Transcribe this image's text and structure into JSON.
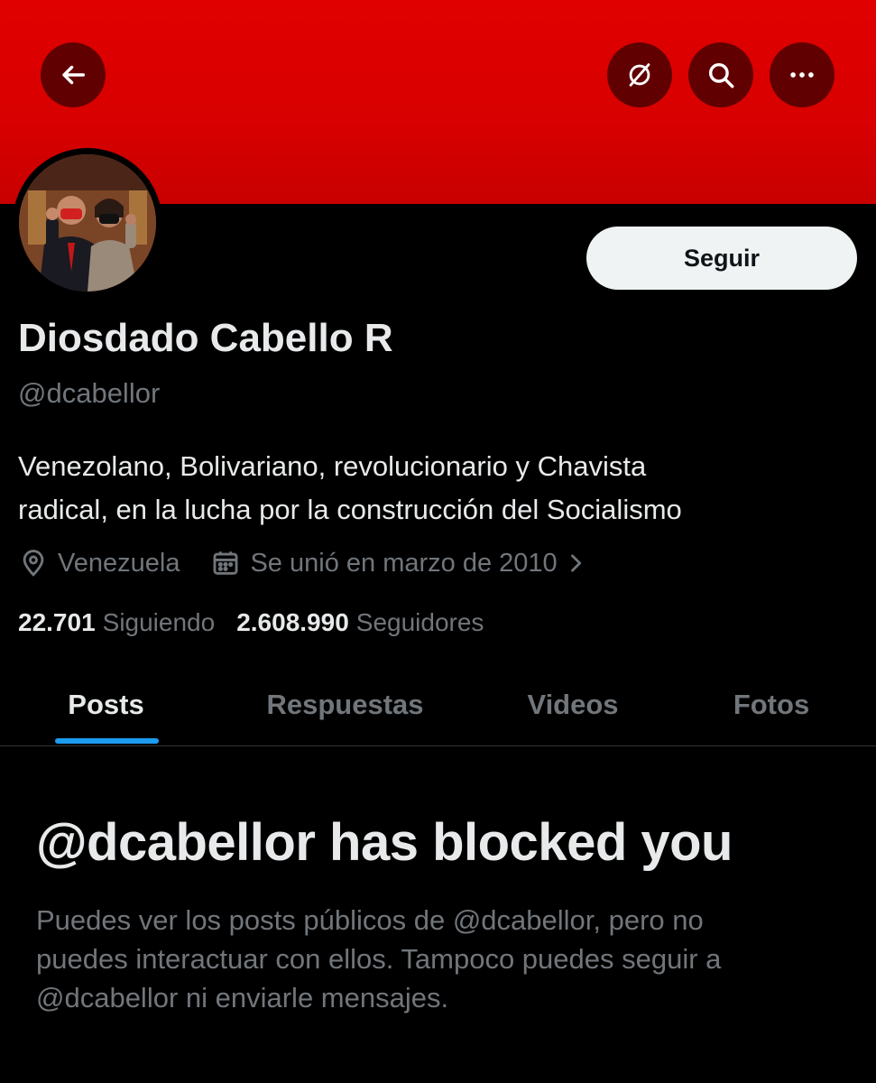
{
  "header": {
    "banner_color": "#d80000",
    "back_icon": "arrow-left-icon",
    "translate_icon": "globe-slash-icon",
    "search_icon": "search-icon",
    "more_icon": "more-horizontal-icon"
  },
  "profile": {
    "name": "Diosdado Cabello R",
    "handle": "@dcabellor",
    "follow_label": "Seguir",
    "bio_line1": "Venezolano, Bolivariano, revolucionario y Chavista",
    "bio_line2": "radical, en la lucha por la construcción del Socialismo",
    "location": "Venezuela",
    "joined": "Se unió en marzo de 2010",
    "following_count": "22.701",
    "following_label": "Siguiendo",
    "followers_count": "2.608.990",
    "followers_label": "Seguidores"
  },
  "tabs": [
    {
      "label": "Posts",
      "active": true
    },
    {
      "label": "Respuestas",
      "active": false
    },
    {
      "label": "Videos",
      "active": false
    },
    {
      "label": "Fotos",
      "active": false
    }
  ],
  "blocked": {
    "title": "@dcabellor has blocked you",
    "line1": "Puedes ver los posts públicos de @dcabellor, pero no",
    "line2": "puedes interactuar con ellos. Tampoco puedes seguir a",
    "line3": "@dcabellor ni enviarle mensajes."
  },
  "colors": {
    "accent": "#1d9bf0",
    "muted_text": "#71767b",
    "primary_text": "#e7e9ea"
  }
}
